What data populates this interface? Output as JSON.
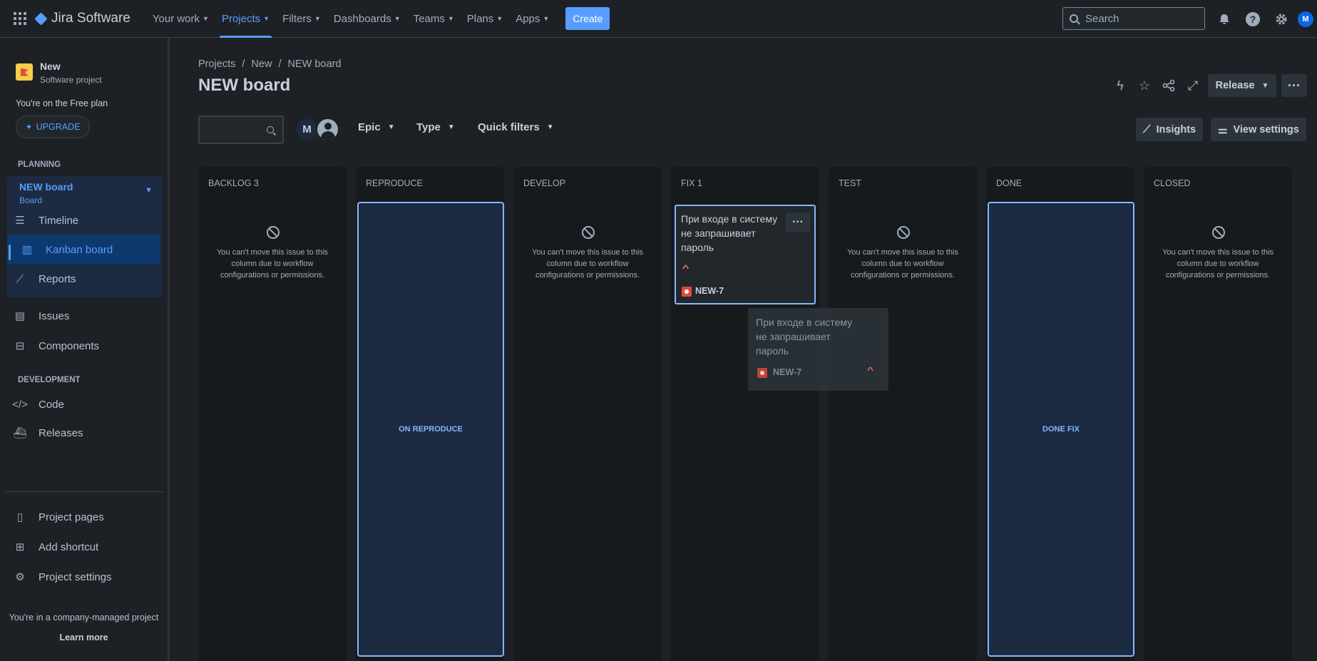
{
  "topbar": {
    "app_name": "Jira Software",
    "nav": [
      {
        "label": "Your work",
        "active": false
      },
      {
        "label": "Projects",
        "active": true
      },
      {
        "label": "Filters",
        "active": false
      },
      {
        "label": "Dashboards",
        "active": false
      },
      {
        "label": "Teams",
        "active": false
      },
      {
        "label": "Plans",
        "active": false
      },
      {
        "label": "Apps",
        "active": false
      }
    ],
    "create_label": "Create",
    "search_placeholder": "Search",
    "avatar_initial": "M"
  },
  "sidebar": {
    "project_name": "New",
    "project_type": "Software project",
    "plan_text": "You're on the Free plan",
    "upgrade_label": "UPGRADE",
    "planning_label": "PLANNING",
    "board_name": "NEW board",
    "board_sub": "Board",
    "planning_items": [
      {
        "label": "Timeline",
        "icon": "timeline-icon"
      },
      {
        "label": "Kanban board",
        "icon": "kanban-board-icon",
        "active": true
      },
      {
        "label": "Reports",
        "icon": "reports-icon"
      }
    ],
    "items": [
      {
        "label": "Issues",
        "icon": "issues-icon"
      },
      {
        "label": "Components",
        "icon": "components-icon"
      }
    ],
    "development_label": "DEVELOPMENT",
    "dev_items": [
      {
        "label": "Code",
        "icon": "code-icon"
      },
      {
        "label": "Releases",
        "icon": "releases-icon"
      }
    ],
    "bottom_items": [
      {
        "label": "Project pages",
        "icon": "project-pages-icon"
      },
      {
        "label": "Add shortcut",
        "icon": "add-shortcut-icon"
      },
      {
        "label": "Project settings",
        "icon": "project-settings-icon"
      }
    ],
    "company_text": "You're in a company-managed project",
    "learn_more": "Learn more"
  },
  "main": {
    "breadcrumb": [
      "Projects",
      "New",
      "NEW board"
    ],
    "title": "NEW board",
    "release_label": "Release",
    "avatar_initial": "M",
    "filters": [
      "Epic",
      "Type",
      "Quick filters"
    ],
    "insights_label": "Insights",
    "view_settings_label": "View settings"
  },
  "columns": [
    {
      "title": "BACKLOG 3",
      "state": "blocked"
    },
    {
      "title": "REPRODUCE",
      "state": "drop",
      "drop_label": "ON REPRODUCE"
    },
    {
      "title": "DEVELOP",
      "state": "blocked"
    },
    {
      "title": "FIX 1",
      "state": "card"
    },
    {
      "title": "TEST",
      "state": "blocked"
    },
    {
      "title": "DONE",
      "state": "drop",
      "drop_label": "DONE FIX"
    },
    {
      "title": "CLOSED",
      "state": "blocked"
    }
  ],
  "blocked_message": "You can't move this issue to this column due to workflow configurations or permissions.",
  "card": {
    "title": "При входе в систему не запрашивает пароль",
    "key": "NEW-7",
    "priority": "high",
    "type": "bug"
  },
  "colors": {
    "accent": "#579dff",
    "background": "#1d2125",
    "column": "#161a1d",
    "drop_zone": "#1c2b41",
    "bug": "#e2483d"
  }
}
